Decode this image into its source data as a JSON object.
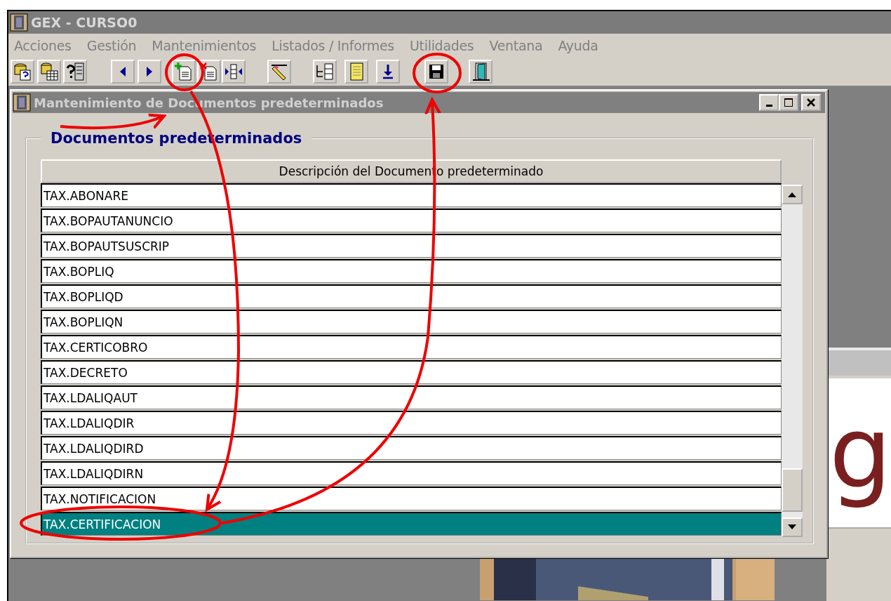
{
  "app": {
    "title": "GEX - CURSO0"
  },
  "menu": [
    "Acciones",
    "Gestión",
    "Mantenimientos",
    "Listados / Informes",
    "Utilidades",
    "Ventana",
    "Ayuda"
  ],
  "toolbar": [
    {
      "kind": "db-help"
    },
    {
      "kind": "db-grid"
    },
    {
      "kind": "help-server"
    },
    {
      "kind": "prev"
    },
    {
      "kind": "next"
    },
    {
      "kind": "new-doc"
    },
    {
      "kind": "delete-doc"
    },
    {
      "kind": "split"
    },
    {
      "kind": "eraser"
    },
    {
      "kind": "tree"
    },
    {
      "kind": "note"
    },
    {
      "kind": "download"
    },
    {
      "kind": "save"
    },
    {
      "kind": "exit"
    }
  ],
  "window": {
    "title": "Mantenimiento de Documentos predeterminados",
    "group_title": "Documentos predeterminados",
    "column": "Descripción del Documento predeterminado",
    "rows": [
      {
        "text": "TAX.ABONARE",
        "selected": false
      },
      {
        "text": "TAX.BOPAUTANUNCIO",
        "selected": false
      },
      {
        "text": "TAX.BOPAUTSUSCRIP",
        "selected": false
      },
      {
        "text": "TAX.BOPLIQ",
        "selected": false
      },
      {
        "text": "TAX.BOPLIQD",
        "selected": false
      },
      {
        "text": "TAX.BOPLIQN",
        "selected": false
      },
      {
        "text": "TAX.CERTICOBRO",
        "selected": false
      },
      {
        "text": "TAX.DECRETO",
        "selected": false
      },
      {
        "text": "TAX.LDALIQAUT",
        "selected": false
      },
      {
        "text": "TAX.LDALIQDIR",
        "selected": false
      },
      {
        "text": "TAX.LDALIQDIRD",
        "selected": false
      },
      {
        "text": "TAX.LDALIQDIRN",
        "selected": false
      },
      {
        "text": "TAX.NOTIFICACION",
        "selected": false
      },
      {
        "text": "TAX.CERTIFICACION",
        "selected": true
      }
    ]
  },
  "background_logo": "g"
}
